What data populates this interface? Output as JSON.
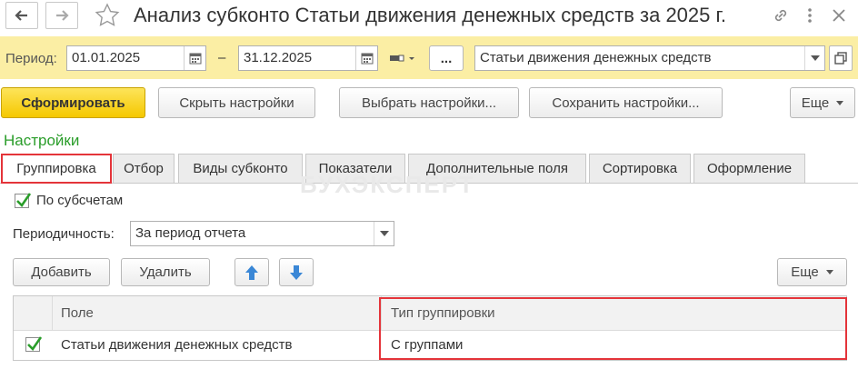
{
  "window": {
    "title": "Анализ субконто Статьи движения денежных средств за 2025 г."
  },
  "period": {
    "label": "Период:",
    "from": "01.01.2025",
    "dash": "–",
    "to": "31.12.2025",
    "more_label": "...",
    "subconto": "Статьи движения денежных средств"
  },
  "toolbar": {
    "generate": "Сформировать",
    "hide_settings": "Скрыть настройки",
    "choose_settings": "Выбрать настройки...",
    "save_settings": "Сохранить настройки...",
    "more": "Еще"
  },
  "settings": {
    "title": "Настройки",
    "tabs": [
      {
        "label": "Группировка"
      },
      {
        "label": "Отбор"
      },
      {
        "label": "Виды субконто"
      },
      {
        "label": "Показатели"
      },
      {
        "label": "Дополнительные поля"
      },
      {
        "label": "Сортировка"
      },
      {
        "label": "Оформление"
      }
    ],
    "active_tab": 0
  },
  "grouping": {
    "by_subaccounts_label": "По субсчетам",
    "by_subaccounts_checked": true,
    "periodicity_label": "Периодичность:",
    "periodicity_value": "За период отчета",
    "add": "Добавить",
    "delete": "Удалить",
    "more": "Еще"
  },
  "table": {
    "columns": [
      "Поле",
      "Тип группировки"
    ],
    "rows": [
      {
        "checked": true,
        "field": "Статьи движения денежных средств",
        "type": "С группами"
      }
    ]
  },
  "watermark": "БУХЭКСПЕРТ",
  "colors": {
    "accent_green": "#2a9d2a",
    "highlight_red": "#e4343a",
    "period_bar": "#fbeea4",
    "primary_button": "#f5c800",
    "arrow_blue": "#3a87d6"
  }
}
